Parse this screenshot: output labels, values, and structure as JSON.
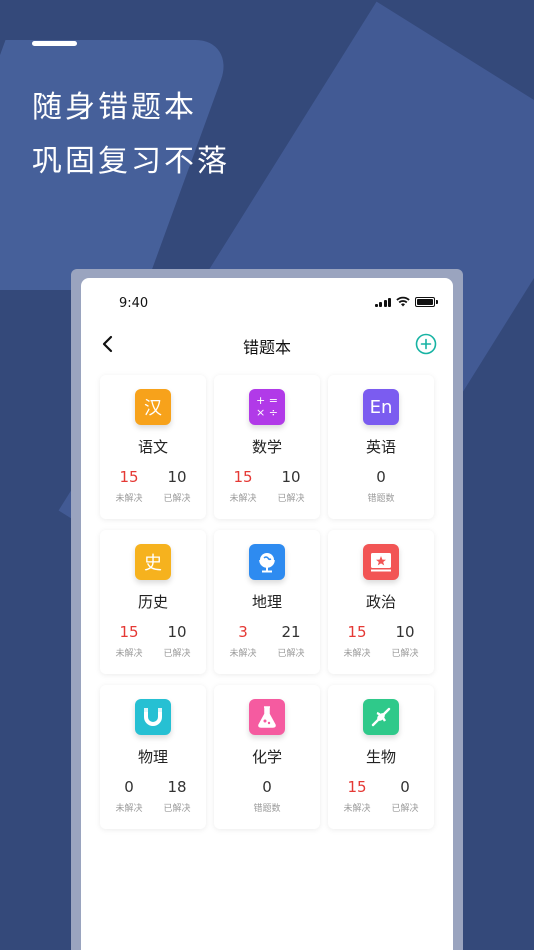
{
  "headline": {
    "line1": "随身错题本",
    "line2": "巩固复习不落"
  },
  "status_bar": {
    "time": "9:40",
    "icons": [
      "signal-icon",
      "wifi-icon",
      "battery-icon"
    ]
  },
  "nav": {
    "title": "错题本",
    "back_icon": "chevron-left-icon",
    "add_icon": "plus-circle-icon"
  },
  "colors": {
    "background": "#34497a",
    "accent_add": "#17b3a3",
    "unsolved_red": "#e53935"
  },
  "subjects": [
    {
      "name": "语文",
      "icon_text": "汉",
      "icon_color": "#f7a21b",
      "stats": [
        {
          "value": "15",
          "label": "未解决",
          "highlight": true
        },
        {
          "value": "10",
          "label": "已解决",
          "highlight": false
        }
      ]
    },
    {
      "name": "数学",
      "icon_text": "+ =\n× ÷",
      "icon_color": "#b13ae8",
      "stats": [
        {
          "value": "15",
          "label": "未解决",
          "highlight": true
        },
        {
          "value": "10",
          "label": "已解决",
          "highlight": false
        }
      ]
    },
    {
      "name": "英语",
      "icon_text": "En",
      "icon_color": "#7b5cf0",
      "stats": [
        {
          "value": "0",
          "label": "错题数",
          "highlight": false
        }
      ]
    },
    {
      "name": "历史",
      "icon_text": "史",
      "icon_color": "#f6b21e",
      "stats": [
        {
          "value": "15",
          "label": "未解决",
          "highlight": true
        },
        {
          "value": "10",
          "label": "已解决",
          "highlight": false
        }
      ]
    },
    {
      "name": "地理",
      "icon_text": "",
      "icon_color": "#2e8bf0",
      "stats": [
        {
          "value": "3",
          "label": "未解决",
          "highlight": true
        },
        {
          "value": "21",
          "label": "已解决",
          "highlight": false
        }
      ]
    },
    {
      "name": "政治",
      "icon_text": "",
      "icon_color": "#f25555",
      "stats": [
        {
          "value": "15",
          "label": "未解决",
          "highlight": true
        },
        {
          "value": "10",
          "label": "已解决",
          "highlight": false
        }
      ]
    },
    {
      "name": "物理",
      "icon_text": "",
      "icon_color": "#26c0d3",
      "stats": [
        {
          "value": "0",
          "label": "未解决",
          "highlight": false
        },
        {
          "value": "18",
          "label": "已解决",
          "highlight": false
        }
      ]
    },
    {
      "name": "化学",
      "icon_text": "",
      "icon_color": "#f55ba0",
      "stats": [
        {
          "value": "0",
          "label": "错题数",
          "highlight": false
        }
      ]
    },
    {
      "name": "生物",
      "icon_text": "",
      "icon_color": "#2fc98a",
      "stats": [
        {
          "value": "15",
          "label": "未解决",
          "highlight": true
        },
        {
          "value": "0",
          "label": "已解决",
          "highlight": false
        }
      ]
    }
  ]
}
